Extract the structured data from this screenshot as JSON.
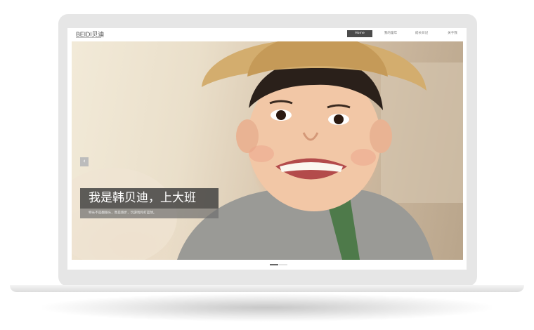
{
  "site": {
    "logo_text": "BEIDI贝迪",
    "nav": [
      {
        "label": "Home",
        "active": true
      },
      {
        "label": "我的童年",
        "active": false
      },
      {
        "label": "成长日记",
        "active": false
      },
      {
        "label": "关于我",
        "active": false
      }
    ]
  },
  "hero": {
    "title": "我是韩贝迪，上大班",
    "subtitle": "特长不是翻跟头，而是跑步，玩游戏和打篮球。",
    "prev_icon": "chevron-left-icon",
    "prev_glyph": "‹"
  },
  "slider": {
    "slide_count": 2,
    "active_index": 0
  }
}
